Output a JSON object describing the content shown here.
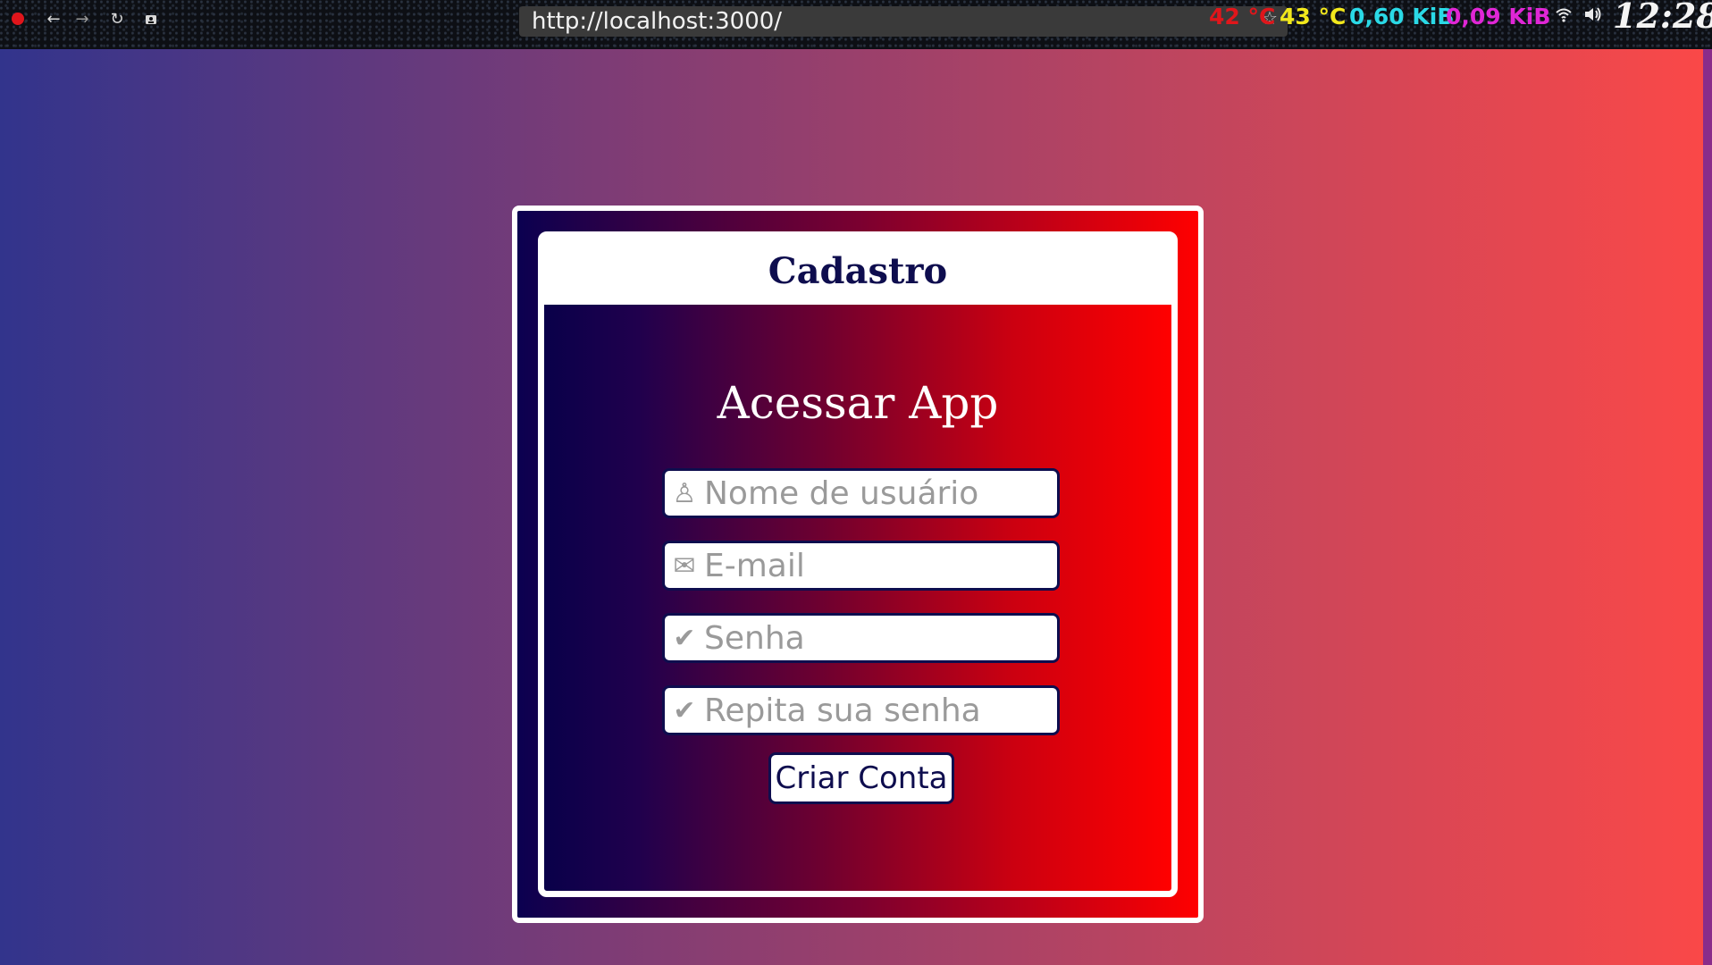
{
  "browser": {
    "url": "http://localhost:3000/",
    "back_glyph": "←",
    "forward_glyph": "→",
    "reload_glyph": "↻",
    "star_glyph": "☆"
  },
  "system_bar": {
    "temp1": "42 °C",
    "temp2": "43 °C",
    "net_down": "0,60 KiB",
    "net_up": "0,09 KiB",
    "clock": "12:28",
    "colors": {
      "temp1": "#e0161b",
      "temp2": "#f2e81c",
      "net_down": "#2ad9e6",
      "net_up": "#e026d6"
    }
  },
  "form": {
    "header_title": "Cadastro",
    "subtitle": "Acessar App",
    "fields": [
      {
        "icon": "user-icon",
        "glyph": "♙",
        "placeholder": "Nome de usuário"
      },
      {
        "icon": "mail-icon",
        "glyph": "✉",
        "placeholder": "E-mail"
      },
      {
        "icon": "check-icon",
        "glyph": "✔",
        "placeholder": "Senha"
      },
      {
        "icon": "check-icon",
        "glyph": "✔",
        "placeholder": "Repita sua senha"
      }
    ],
    "submit_label": "Criar Conta"
  },
  "colors": {
    "page_gradient_left": "#32348c",
    "page_gradient_right": "#fa4848",
    "card_gradient_left": "#09004a",
    "card_gradient_right": "#ff0000",
    "title_navy": "#0e0d4e"
  }
}
